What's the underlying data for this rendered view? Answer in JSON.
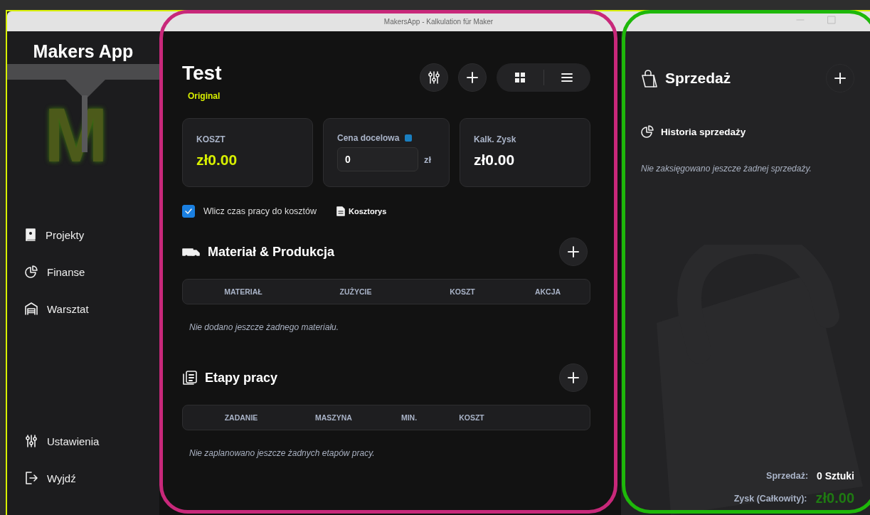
{
  "window": {
    "title": "MakersApp - Kalkulation für Maker"
  },
  "sidebar": {
    "logo": "Makers App",
    "logo_mark": "M",
    "items": [
      {
        "label": "Projekty"
      },
      {
        "label": "Finanse"
      },
      {
        "label": "Warsztat"
      }
    ],
    "bottom_items": [
      {
        "label": "Ustawienia"
      },
      {
        "label": "Wyjdź"
      }
    ]
  },
  "project": {
    "title": "Test",
    "badge": "Original",
    "cards": [
      {
        "kind": "value",
        "label": "KOSZT",
        "value": "zł0.00",
        "highlight": true
      },
      {
        "kind": "input",
        "label": "Cena docelowa",
        "value": "0",
        "unit": "zł"
      },
      {
        "kind": "value",
        "label": "Kalk. Zysk",
        "value": "zł0.00",
        "highlight": false
      }
    ],
    "include_labor": {
      "label": "Wlicz czas pracy do kosztów",
      "checked": true
    },
    "estimate_link": "Kosztorys",
    "sections": [
      {
        "kind": "materials",
        "title": "Materiał & Produkcja",
        "columns": [
          "MATERIAŁ",
          "ZUŻYCIE",
          "KOSZT",
          "AKCJA"
        ],
        "empty": "Nie dodano jeszcze żadnego materiału."
      },
      {
        "kind": "steps",
        "title": "Etapy pracy",
        "columns": [
          "ZADANIE",
          "MASZYNA",
          "MIN.",
          "KOSZT"
        ],
        "empty": "Nie zaplanowano jeszcze żadnych etapów pracy."
      }
    ]
  },
  "sales": {
    "title": "Sprzedaż",
    "history_title": "Historia sprzedaży",
    "empty": "Nie zaksięgowano jeszcze żadnej sprzedaży.",
    "summary": [
      {
        "kind": "count",
        "label": "Sprzedaż:",
        "value": "0 Sztuki"
      },
      {
        "kind": "profit",
        "label": "Zysk (Całkowity):",
        "value": "zł0.00"
      }
    ]
  }
}
